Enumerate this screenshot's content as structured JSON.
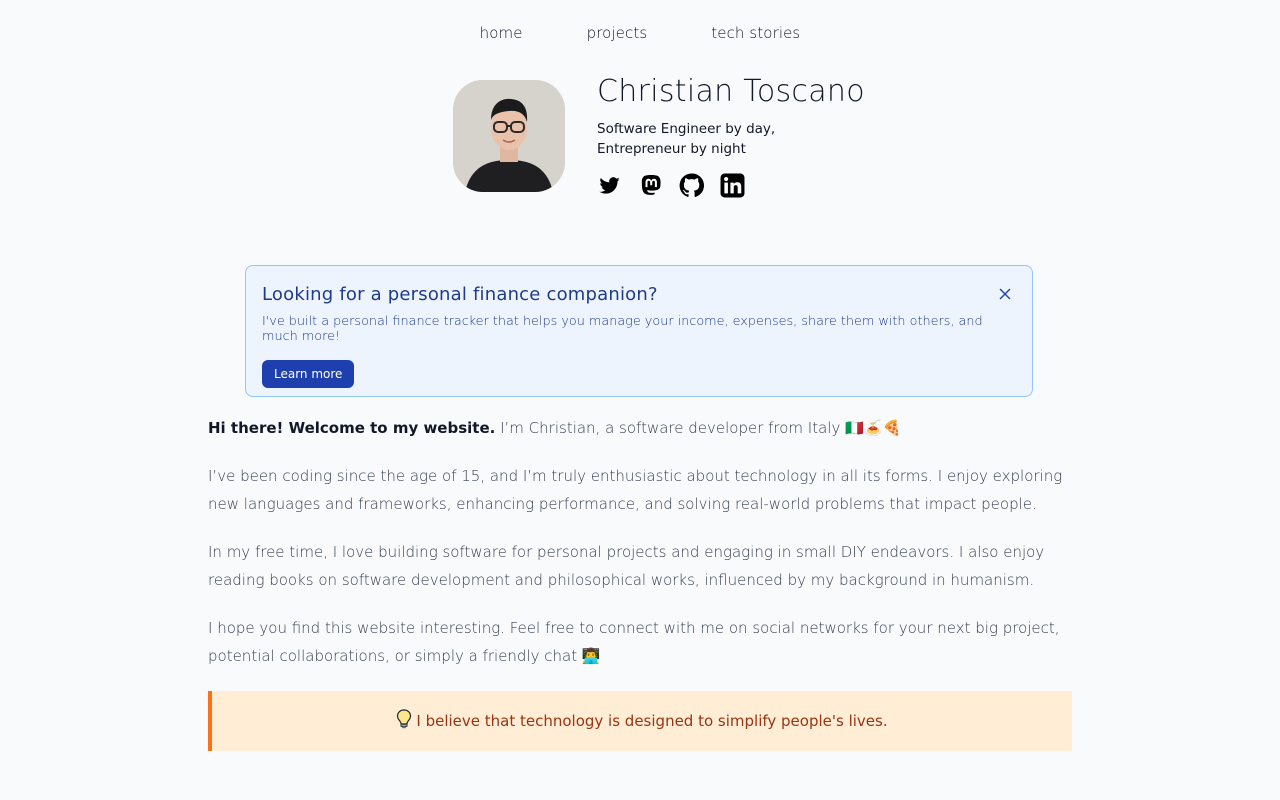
{
  "nav": {
    "items": [
      {
        "label": "home"
      },
      {
        "label": "projects"
      },
      {
        "label": "tech stories"
      }
    ]
  },
  "profile": {
    "name": "Christian Toscano",
    "tagline_line1": "Software Engineer by day,",
    "tagline_line2": "Entrepreneur by night",
    "socials": [
      "twitter-icon",
      "mastodon-icon",
      "github-icon",
      "linkedin-icon"
    ]
  },
  "banner": {
    "title": "Looking for a personal finance companion?",
    "text": "I've built a personal finance tracker that helps you manage your income, expenses, share them with others, and much more!",
    "button": "Learn more"
  },
  "intro": {
    "greeting": "Hi there! Welcome to my website.",
    "rest": " I’m Christian, a software developer from Italy 🇮🇹🍝🍕",
    "p2": "I’ve been coding since the age of 15, and I’m truly enthusiastic about technology in all its forms. I enjoy exploring new languages and frameworks, enhancing performance, and solving real-world problems that impact people.",
    "p3": "In my free time, I love building software for personal projects and engaging in small DIY endeavors. I also enjoy reading books on software development and philosophical works, influenced by my background in humanism.",
    "p4": "I hope you find this website interesting. Feel free to connect with me on social networks for your next big project, potential collaborations, or simply a friendly chat 👨‍💻"
  },
  "quote": {
    "text": "I believe that technology is designed to simplify people's lives."
  },
  "colors": {
    "background": "#f8fafc",
    "banner_border": "#93c5fd",
    "banner_bg": "#eef4fe",
    "button": "#1e40af",
    "quote_bg": "#ffedd5",
    "quote_accent": "#f97316"
  }
}
